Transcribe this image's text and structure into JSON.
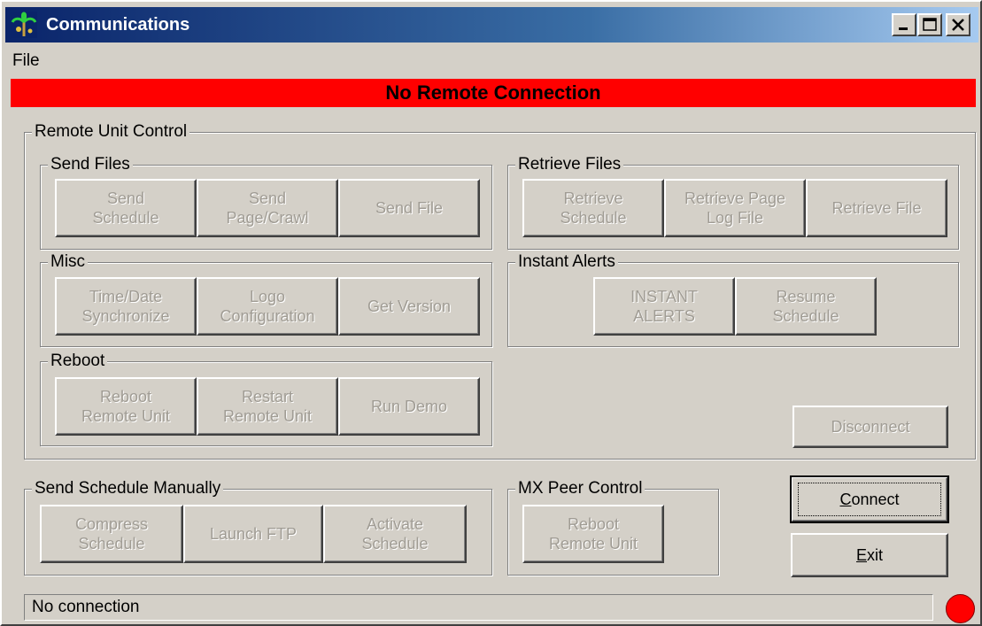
{
  "window": {
    "title": "Communications",
    "app_icon": "palm-tree-icon"
  },
  "caption_buttons": {
    "minimize": "minimize-icon",
    "maximize": "maximize-icon",
    "close": "close-icon"
  },
  "menu": {
    "file": "File"
  },
  "banner": {
    "text": "No Remote Connection",
    "color": "#ff0000"
  },
  "remote_unit_control": {
    "legend": "Remote Unit Control",
    "send_files": {
      "legend": "Send Files",
      "buttons": [
        "Send\nSchedule",
        "Send\nPage/Crawl",
        "Send File"
      ]
    },
    "retrieve_files": {
      "legend": "Retrieve Files",
      "buttons": [
        "Retrieve\nSchedule",
        "Retrieve Page\nLog File",
        "Retrieve File"
      ]
    },
    "misc": {
      "legend": "Misc",
      "buttons": [
        "Time/Date\nSynchronize",
        "Logo\nConfiguration",
        "Get Version"
      ]
    },
    "instant_alerts": {
      "legend": "Instant Alerts",
      "buttons": [
        "INSTANT\nALERTS",
        "Resume\nSchedule"
      ]
    },
    "reboot": {
      "legend": "Reboot",
      "buttons": [
        "Reboot\nRemote Unit",
        "Restart\nRemote Unit",
        "Run Demo"
      ]
    },
    "disconnect": "Disconnect"
  },
  "send_schedule_manually": {
    "legend": "Send Schedule Manually",
    "buttons": [
      "Compress\nSchedule",
      "Launch FTP",
      "Activate\nSchedule"
    ]
  },
  "mx_peer_control": {
    "legend": "MX Peer Control",
    "buttons": [
      "Reboot\nRemote Unit"
    ]
  },
  "actions": {
    "connect_rest": "onnect",
    "connect_mnemonic": "C",
    "exit_rest": "xit",
    "exit_mnemonic": "E"
  },
  "status": {
    "text": "No connection",
    "indicator_color": "#ff0000"
  }
}
